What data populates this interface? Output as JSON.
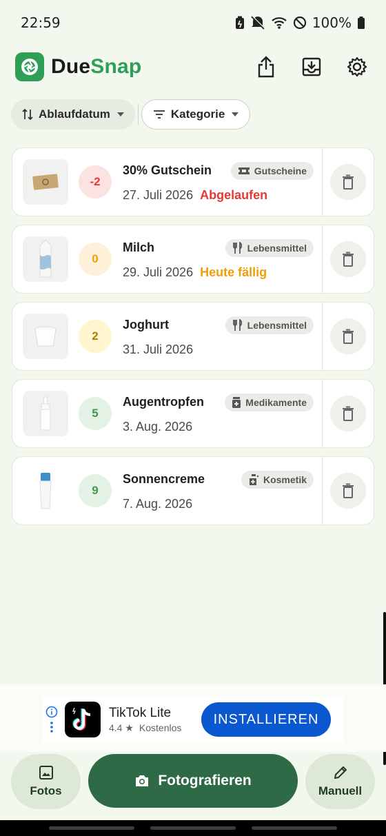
{
  "status_bar": {
    "time": "22:59",
    "battery": "100%"
  },
  "app": {
    "title_part1": "Due",
    "title_part2": "Snap"
  },
  "filters": {
    "sort_label": "Ablaufdatum",
    "category_label": "Kategorie"
  },
  "items": [
    {
      "name": "30% Gutschein",
      "days": "-2",
      "date": "27. Juli 2026",
      "status": "Abgelaufen",
      "category": "Gutscheine",
      "category_icon": "ticket-icon",
      "days_bg": "#fde2e2",
      "days_color": "#e53935",
      "status_color": "#e53935"
    },
    {
      "name": "Milch",
      "days": "0",
      "date": "29. Juli 2026",
      "status": "Heute fällig",
      "category": "Lebensmittel",
      "category_icon": "restaurant-icon",
      "days_bg": "#fff0d9",
      "days_color": "#f29d0a",
      "status_color": "#f29d0a"
    },
    {
      "name": "Joghurt",
      "days": "2",
      "date": "31. Juli 2026",
      "status": "",
      "category": "Lebensmittel",
      "category_icon": "restaurant-icon",
      "days_bg": "#fff6cf",
      "days_color": "#a38300",
      "status_color": "#a38300"
    },
    {
      "name": "Augentropfen",
      "days": "5",
      "date": "3. Aug. 2026",
      "status": "",
      "category": "Medikamente",
      "category_icon": "medical-icon",
      "days_bg": "#e3f2e4",
      "days_color": "#3f9a4a",
      "status_color": "#3f9a4a"
    },
    {
      "name": "Sonnencreme",
      "days": "9",
      "date": "7. Aug. 2026",
      "status": "",
      "category": "Kosmetik",
      "category_icon": "sanitizer-icon",
      "days_bg": "#e3f2e4",
      "days_color": "#3f9a4a",
      "status_color": "#3f9a4a"
    }
  ],
  "ad": {
    "title": "TikTok Lite",
    "rating": "4.4",
    "price": "Kostenlos",
    "cta": "INSTALLIEREN"
  },
  "bottom": {
    "photos_label": "Fotos",
    "camera_label": "Fotografieren",
    "manual_label": "Manuell"
  },
  "colors": {
    "brand": "#2f9e57",
    "main_button": "#2e6a45",
    "ad_cta": "#0b57d0"
  }
}
